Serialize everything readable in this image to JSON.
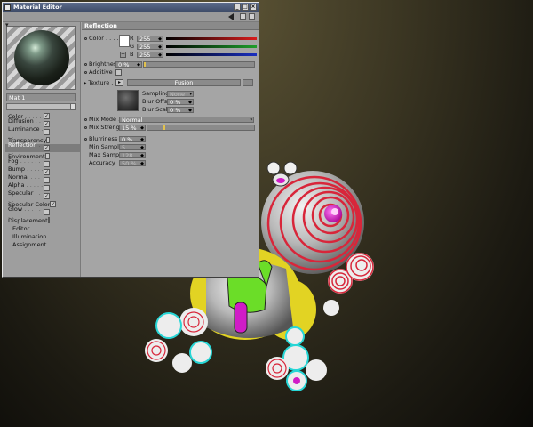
{
  "window": {
    "title": "Material Editor"
  },
  "material": {
    "name": "Mat 1"
  },
  "channels": [
    {
      "label": "Color",
      "dots": ". . . . .",
      "checked": true,
      "selected": false
    },
    {
      "label": "Diffusion",
      "dots": ". . . .",
      "checked": true,
      "selected": false
    },
    {
      "label": "Luminance",
      "dots": ". . .",
      "checked": false,
      "selected": false
    },
    {
      "label": "Transparency",
      "dots": "",
      "checked": false,
      "selected": false
    },
    {
      "label": "Reflection",
      "dots": ". . .",
      "checked": true,
      "selected": true
    },
    {
      "label": "Environment",
      "dots": "",
      "checked": false,
      "selected": false
    },
    {
      "label": "Fog",
      "dots": ". . . . . . .",
      "checked": false,
      "selected": false
    },
    {
      "label": "Bump",
      "dots": ". . . . . .",
      "checked": true,
      "selected": false
    },
    {
      "label": "Normal",
      "dots": ". . . . .",
      "checked": false,
      "selected": false
    },
    {
      "label": "Alpha",
      "dots": ". . . . . .",
      "checked": false,
      "selected": false
    },
    {
      "label": "Specular",
      "dots": ". . . .",
      "checked": true,
      "selected": false
    },
    {
      "label": "Specular Color",
      "dots": "",
      "checked": true,
      "selected": false
    },
    {
      "label": "Glow",
      "dots": ". . . . . . .",
      "checked": false,
      "selected": false
    },
    {
      "label": "Displacement",
      "dots": "",
      "checked": false,
      "selected": false
    }
  ],
  "channel_extras": [
    "Editor",
    "Illumination",
    "Assignment"
  ],
  "panel": {
    "title": "Reflection",
    "color_label": "Color",
    "r_label": "R",
    "r_value": "255",
    "g_label": "G",
    "g_value": "255",
    "b_label": "B",
    "b_value": "255",
    "brightness_label": "Brightness",
    "brightness_value": "0 %",
    "additive_label": "Additive",
    "texture_label": "Texture",
    "texture_name": "Fusion",
    "sampling_label": "Sampling",
    "sampling_value": "None",
    "blur_offset_label": "Blur Offset",
    "blur_offset_value": "0 %",
    "blur_scale_label": "Blur Scale",
    "blur_scale_value": "0 %",
    "mix_mode_label": "Mix Mode",
    "mix_mode_value": "Normal",
    "mix_strength_label": "Mix Strength",
    "mix_strength_value": "15 %",
    "mix_strength_fraction": 0.15,
    "blurriness_label": "Blurriness",
    "blurriness_value": "0 %",
    "min_samples_label": "Min Samples",
    "min_samples_value": "5",
    "max_samples_label": "Max Samples",
    "max_samples_value": "128",
    "accuracy_label": "Accuracy",
    "accuracy_value": "50 %"
  },
  "colors": {
    "red_bar": "#d81d1d",
    "green_bar": "#1f9e2c",
    "blue_bar": "#1a2fc0",
    "titlebar": "#4a5878",
    "robot_body": "#c9c9c9",
    "robot_red": "#d8263a",
    "robot_magenta": "#d01cc7",
    "robot_green": "#6bdd28",
    "robot_yellow": "#e2d323",
    "robot_cyan": "#27d6d6"
  }
}
